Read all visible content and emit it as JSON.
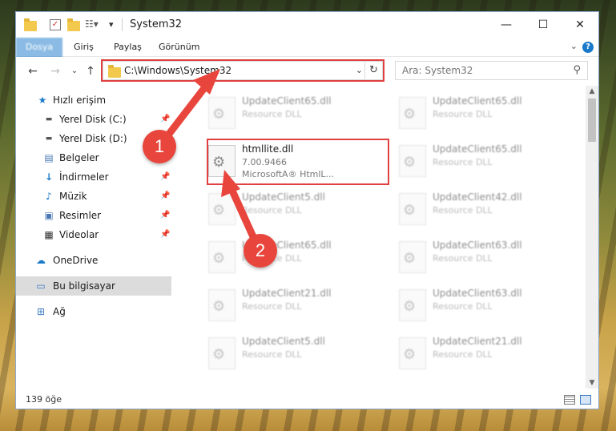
{
  "window": {
    "title": "System32",
    "controls": {
      "minimize": "—",
      "maximize": "☐",
      "close": "✕"
    }
  },
  "ribbon": {
    "tabs": [
      "Dosya",
      "Giriş",
      "Paylaş",
      "Görünüm"
    ]
  },
  "navigation": {
    "address": "C:\\Windows\\System32",
    "search_placeholder": "Ara: System32"
  },
  "sidebar": {
    "items": [
      {
        "label": "Hızlı erişim",
        "icon": "star-icon",
        "pinned": false
      },
      {
        "label": "Yerel Disk (C:)",
        "icon": "drive-icon",
        "pinned": true
      },
      {
        "label": "Yerel Disk (D:)",
        "icon": "drive-icon",
        "pinned": false
      },
      {
        "label": "Belgeler",
        "icon": "documents-icon",
        "pinned": true
      },
      {
        "label": "İndirmeler",
        "icon": "download-icon",
        "pinned": true
      },
      {
        "label": "Müzik",
        "icon": "music-icon",
        "pinned": true
      },
      {
        "label": "Resimler",
        "icon": "pictures-icon",
        "pinned": true
      },
      {
        "label": "Videolar",
        "icon": "videos-icon",
        "pinned": true
      },
      {
        "label": "OneDrive",
        "icon": "cloud-icon",
        "pinned": false
      },
      {
        "label": "Bu bilgisayar",
        "icon": "computer-icon",
        "pinned": false,
        "selected": true
      },
      {
        "label": "Ağ",
        "icon": "network-icon",
        "pinned": false
      }
    ]
  },
  "files": [
    {
      "name": "UpdateClient65.dll",
      "line2": "Resource DLL",
      "line3": ""
    },
    {
      "name": "UpdateClient65.dll",
      "line2": "Resource DLL",
      "line3": ""
    },
    {
      "name": "htmllite.dll",
      "line2": "7.00.9466",
      "line3": "MicrosoftA® HtmlL...",
      "highlighted": true
    },
    {
      "name": "UpdateClient65.dll",
      "line2": "Resource DLL",
      "line3": ""
    },
    {
      "name": "UpdateClient5.dll",
      "line2": "Resource DLL",
      "line3": ""
    },
    {
      "name": "UpdateClient42.dll",
      "line2": "Resource DLL",
      "line3": ""
    },
    {
      "name": "UpdateClient65.dll",
      "line2": "Resource DLL",
      "line3": ""
    },
    {
      "name": "UpdateClient63.dll",
      "line2": "Resource DLL",
      "line3": ""
    },
    {
      "name": "UpdateClient21.dll",
      "line2": "Resource DLL",
      "line3": ""
    },
    {
      "name": "UpdateClient63.dll",
      "line2": "Resource DLL",
      "line3": ""
    },
    {
      "name": "UpdateClient5.dll",
      "line2": "Resource DLL",
      "line3": ""
    },
    {
      "name": "UpdateClient21.dll",
      "line2": "Resource DLL",
      "line3": ""
    }
  ],
  "status": {
    "item_count": "139 öğe"
  },
  "annotations": {
    "step1": "1",
    "step2": "2"
  },
  "colors": {
    "accent": "#1979ca",
    "annotation": "#e8453c",
    "highlight": "#e04040"
  }
}
